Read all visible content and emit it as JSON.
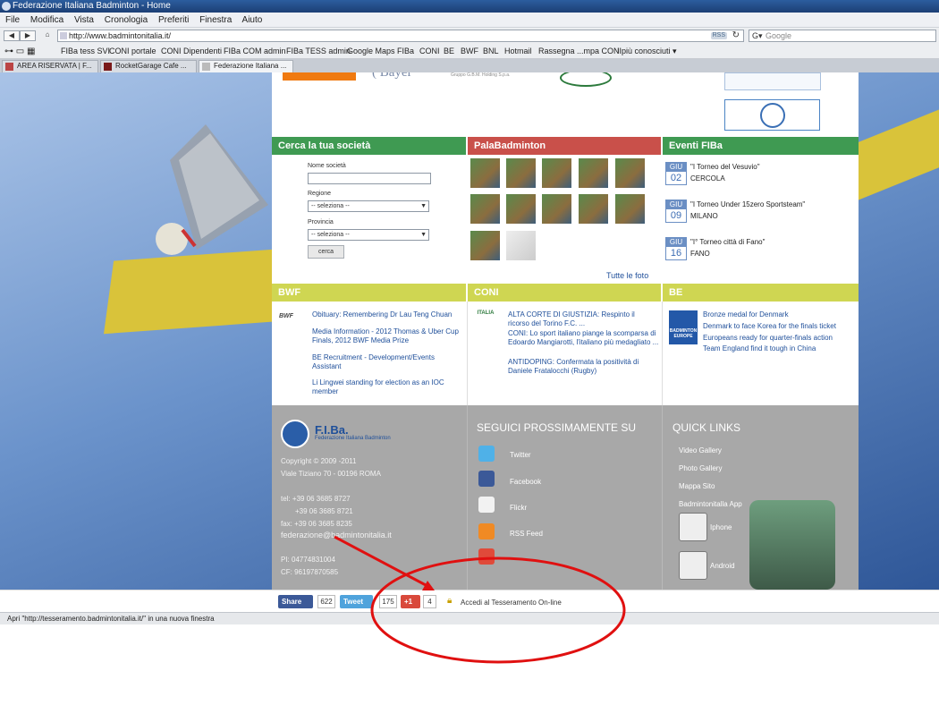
{
  "window": {
    "title": "Federazione Italiana Badminton - Home"
  },
  "menu": [
    "File",
    "Modifica",
    "Vista",
    "Cronologia",
    "Preferiti",
    "Finestra",
    "Aiuto"
  ],
  "nav": {
    "url": "http://www.badmintonitalia.it/",
    "rss": "RSS",
    "search_placeholder": "Google"
  },
  "bookmarks": [
    "FIBa tess SVI",
    "CONI portale",
    "CONI Dipendenti",
    "FIBa COM admin",
    "FIBa TESS admin",
    "Google Maps",
    "FIBa",
    "CONI",
    "BE",
    "BWF",
    "BNL",
    "Hotmail",
    "Rassegna ...mpa CONI",
    "I più conosciuti ▾"
  ],
  "tabs": [
    "AREA RISERVATA | F...",
    "RocketGarage Cafe ...",
    "Federazione Italiana ..."
  ],
  "search_soc": {
    "title": "Cerca la tua società",
    "name_label": "Nome società",
    "region_label": "Regione",
    "region_value": "-- seleziona --",
    "province_label": "Provincia",
    "province_value": "-- seleziona --",
    "button": "cerca"
  },
  "pala": {
    "title": "PalaBadminton",
    "all_photos": "Tutte le foto"
  },
  "events": {
    "title": "Eventi FIBa",
    "items": [
      {
        "month": "GIU",
        "day": "02",
        "name": "\"I Torneo del Vesuvio\"",
        "place": "CERCOLA"
      },
      {
        "month": "GIU",
        "day": "09",
        "name": "\"I Torneo Under 15zero Sportsteam\"",
        "place": "MILANO"
      },
      {
        "month": "GIU",
        "day": "16",
        "name": "\"I° Torneo città di Fano\"",
        "place": "FANO"
      }
    ]
  },
  "bwf": {
    "title": "BWF",
    "logo": "BWF",
    "links": [
      "Obituary: Remembering Dr Lau Teng Chuan",
      "Media Information - 2012 Thomas & Uber Cup Finals, 2012 BWF Media Prize",
      "BE Recruitment - Development/Events Assistant",
      "Li Lingwei standing for election as an IOC member"
    ]
  },
  "coni": {
    "title": "CONI",
    "logo": "ITALIA",
    "links": [
      "ALTA CORTE DI GIUSTIZIA: Respinto il ricorso del Torino F.C. ...",
      "CONI: Lo sport italiano piange la scomparsa di Edoardo Mangiarotti, l'italiano più medagliato ...",
      "ANTIDOPING: Confermata la positività di Daniele Fratalocchi (Rugby)"
    ]
  },
  "be": {
    "title": "BE",
    "logo": "BADMINTON EUROPE",
    "links": [
      "Bronze medal for Denmark",
      "Denmark to face Korea for the finals ticket",
      "Europeans ready for quarter-finals action",
      "Team England find it tough in China"
    ]
  },
  "footer": {
    "logo_name": "F.I.Ba.",
    "logo_sub": "Federazione Italiana Badminton",
    "copyright": "Copyright © 2009 -2011",
    "address": "Viale Tiziano 70 - 00196 ROMA",
    "tel1": "tel: +39 06 3685 8727",
    "tel2": "+39 06 3685 8721",
    "fax": "fax: +39 06 3685 8235",
    "email": "federazione@badmintonitalia.it",
    "pi": "PI: 04774831004",
    "cf": "CF: 96197870585",
    "follow_title": "SEGUICI PROSSIMAMENTE SU",
    "social": [
      "Twitter",
      "Facebook",
      "Flickr",
      "RSS Feed"
    ],
    "social_icons": [
      "twitter-icon",
      "facebook-icon",
      "flickr-icon",
      "rss-icon"
    ],
    "quick_title": "QUICK LINKS",
    "quick": [
      "Video Gallery",
      "Photo Gallery",
      "Mappa Sito",
      "Badmintonitalla App"
    ],
    "apps": [
      "Iphone",
      "Android"
    ]
  },
  "share": {
    "fb": "Share",
    "fb_count": "622",
    "tw": "Tweet",
    "tw_count": "175",
    "gp": "+1",
    "gp_count": "4",
    "tess": "Accedi al Tesseramento On-line"
  },
  "status": "Apri \"http://tesseramento.badmintonitalia.it/\" in una nuova finestra",
  "colors": {
    "green": "#3f9a52",
    "red": "#c9504a",
    "yellow": "#cfd652",
    "annotation": "#e01010"
  }
}
